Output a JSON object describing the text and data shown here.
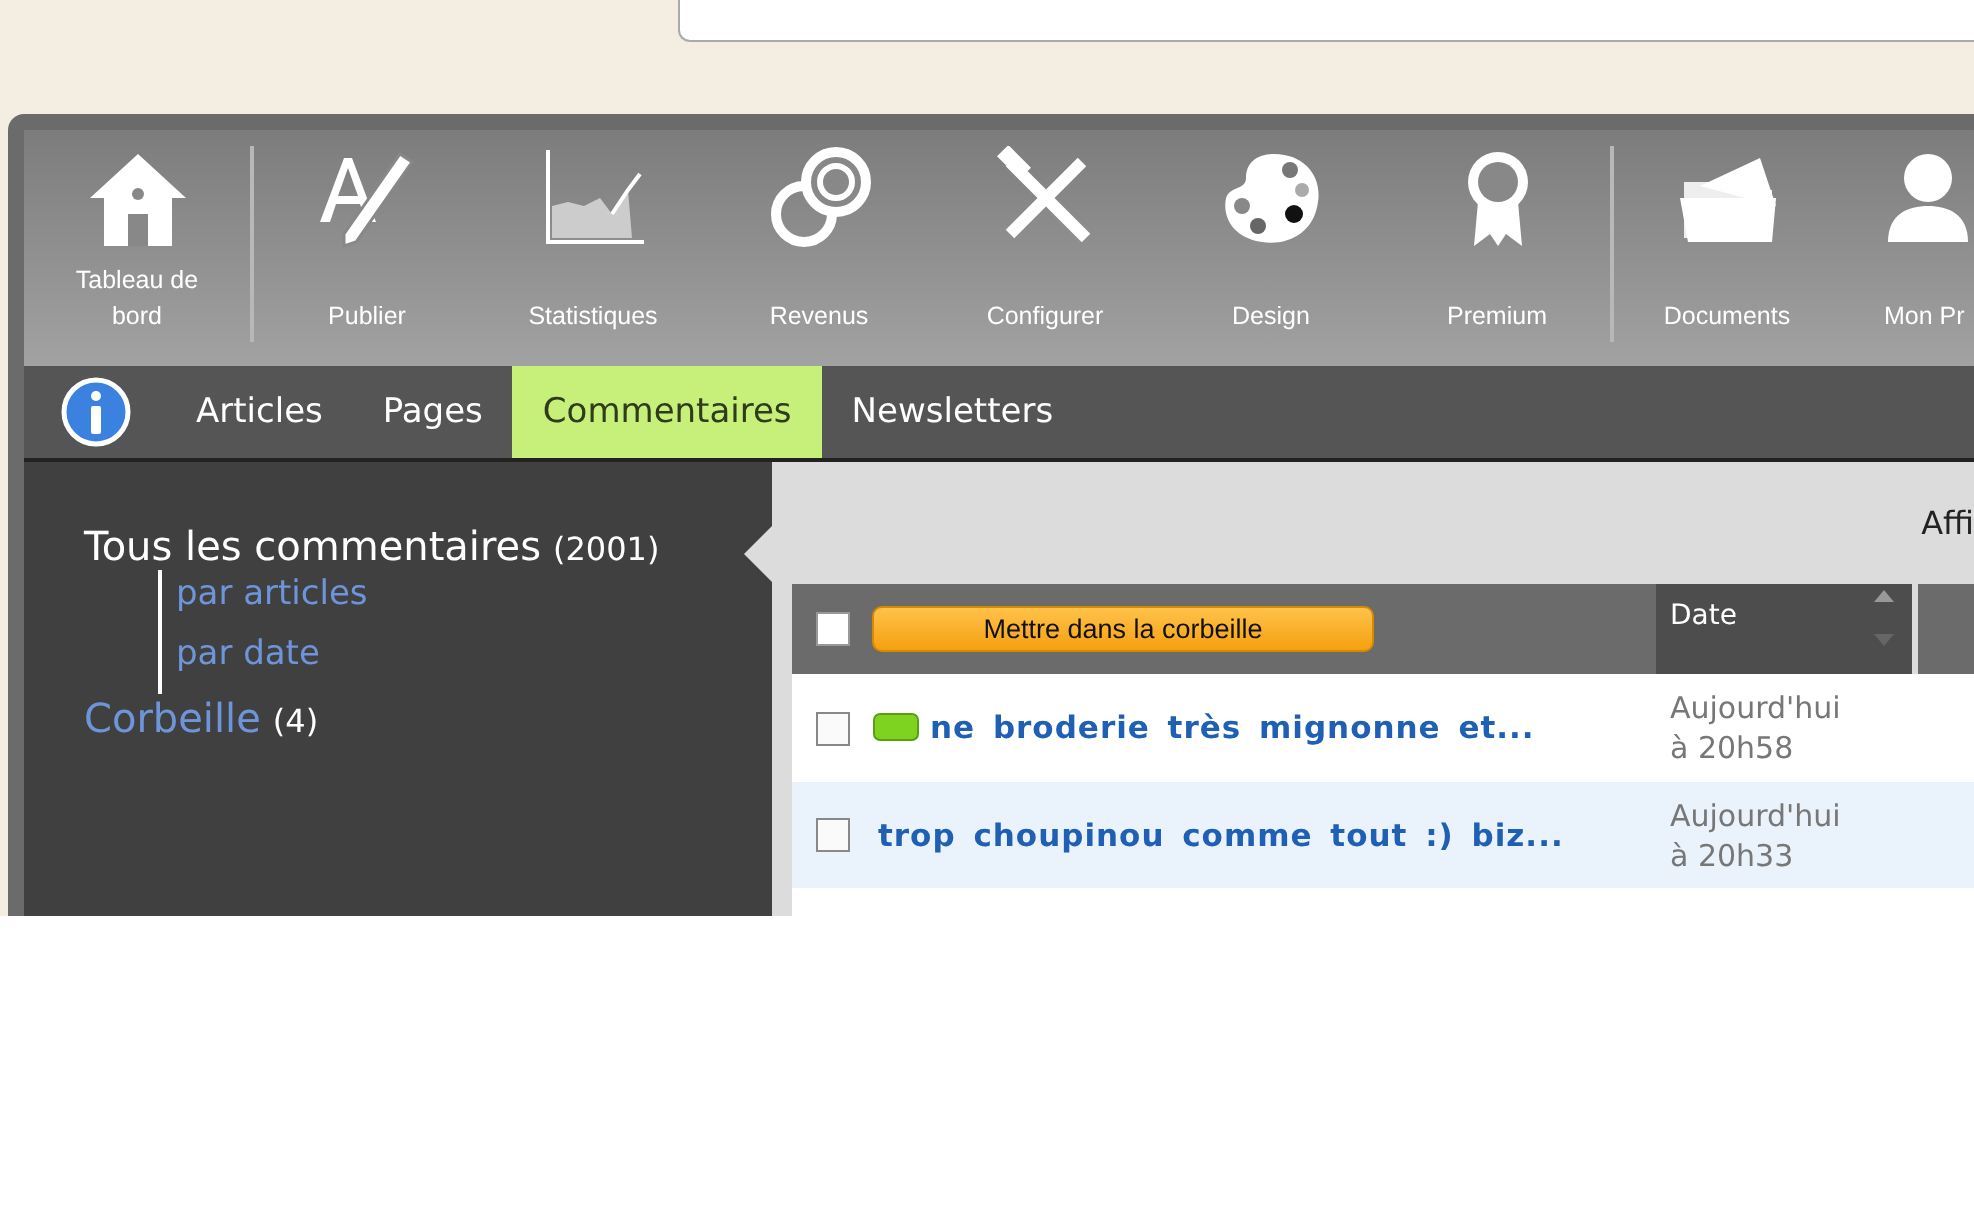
{
  "toolbar": {
    "groups": [
      [
        {
          "label": "Tableau de bord"
        }
      ],
      [
        {
          "label": "Publier"
        },
        {
          "label": "Statistiques"
        },
        {
          "label": "Revenus"
        },
        {
          "label": "Configurer"
        },
        {
          "label": "Design"
        },
        {
          "label": "Premium"
        }
      ],
      [
        {
          "label": "Documents"
        },
        {
          "label": "Mon Pr"
        }
      ]
    ]
  },
  "tabs": [
    {
      "label": "Articles",
      "selected": false
    },
    {
      "label": "Pages",
      "selected": false
    },
    {
      "label": "Commentaires",
      "selected": true
    },
    {
      "label": "Newsletters",
      "selected": false
    }
  ],
  "sidebar": {
    "items": [
      {
        "label": "Tous les commentaires",
        "count": "(2001)",
        "selected": true,
        "children": [
          {
            "label": "par articles"
          },
          {
            "label": "par date"
          }
        ]
      },
      {
        "label": "Corbeille",
        "count": "(4)",
        "selected": false
      }
    ]
  },
  "display_label": "Affi",
  "table": {
    "select_all_checked": false,
    "trash_button": "Mettre dans la corbeille",
    "date_column": "Date",
    "rows": [
      {
        "checked": false,
        "new": true,
        "title": "ne broderie très mignonne et...",
        "date": "Aujourd'hui\nà 20h58"
      },
      {
        "checked": false,
        "new": false,
        "title": "trop choupinou comme tout :) biz...",
        "date": "Aujourd'hui\nà 20h33"
      }
    ]
  }
}
